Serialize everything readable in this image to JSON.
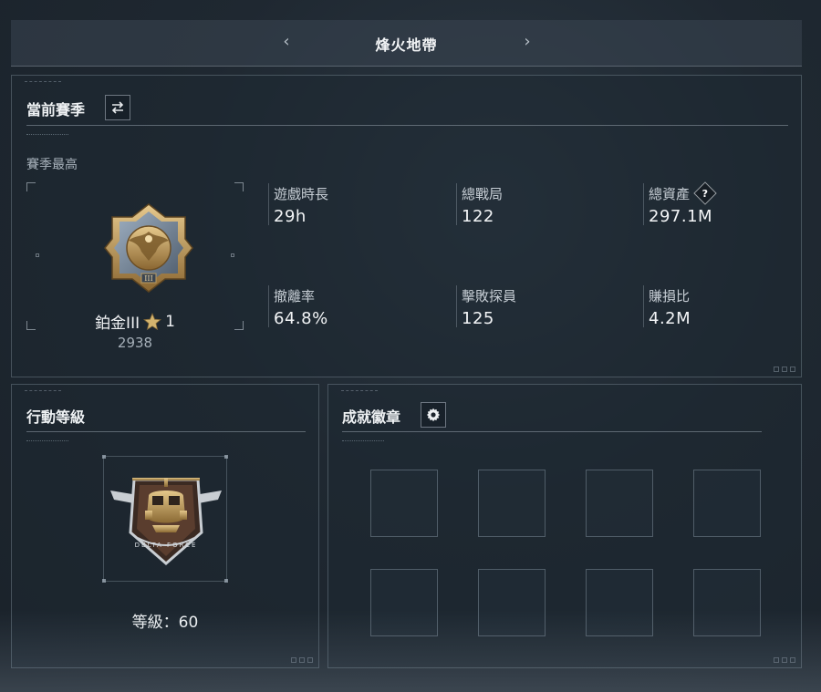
{
  "header": {
    "title": "烽火地帶",
    "prev_icon": "chevron-left-icon",
    "next_icon": "chevron-right-icon",
    "prev_glyph": "‹",
    "next_glyph": "›"
  },
  "season": {
    "title": "當前賽季",
    "switch_icon": "swap-icon",
    "best_label": "賽季最高",
    "rank": {
      "name": "鉑金III",
      "stars": "1",
      "star_icon": "star-icon",
      "score": "2938",
      "roman": "III"
    },
    "stats": [
      {
        "label": "遊戲時長",
        "value": "29h"
      },
      {
        "label": "總戰局",
        "value": "122"
      },
      {
        "label": "總資產",
        "value": "297.1M",
        "help": "?"
      },
      {
        "label": "撤離率",
        "value": "64.8%"
      },
      {
        "label": "擊敗探員",
        "value": "125"
      },
      {
        "label": "賺損比",
        "value": "4.2M"
      }
    ]
  },
  "action_level": {
    "title": "行動等級",
    "level_label": "等級：60",
    "emblem_text": "DELTA FORCE"
  },
  "achievements": {
    "title": "成就徽章",
    "settings_icon": "gear-icon",
    "slots": 8
  },
  "colors": {
    "background": "#1f2831",
    "panel_border": "#96a5b2",
    "text": "#e6e9ec",
    "muted": "#a9b3bc",
    "gold": "#c9a56a",
    "star": "#d4b46e"
  }
}
